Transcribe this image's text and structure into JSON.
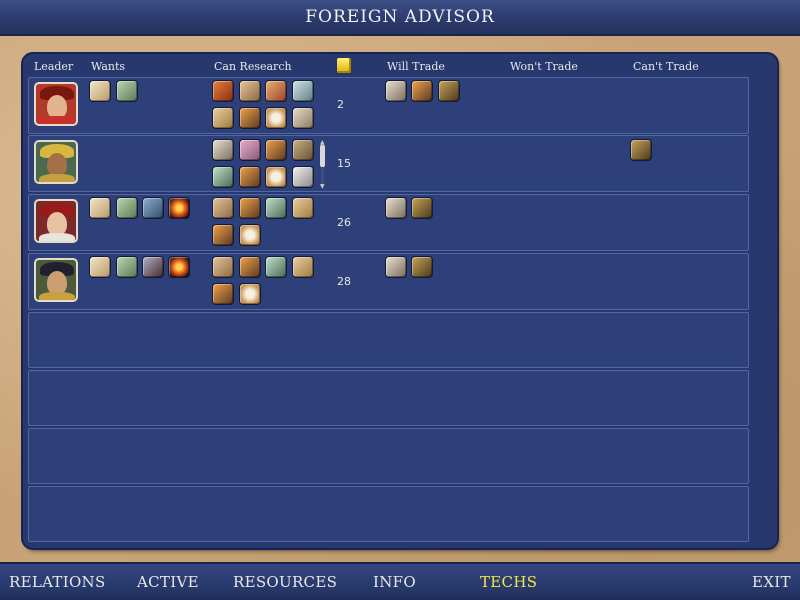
{
  "window": {
    "title": "FOREIGN ADVISOR"
  },
  "headers": {
    "leader": "Leader",
    "wants": "Wants",
    "can_research": "Can Research",
    "gold_icon": "gold-coin-icon",
    "will_trade": "Will Trade",
    "wont_trade": "Won't Trade",
    "cant_trade": "Can't Trade"
  },
  "leaders": [
    {
      "gold": "2"
    },
    {
      "gold": "15"
    },
    {
      "gold": "26"
    },
    {
      "gold": "28"
    }
  ],
  "nav": {
    "relations": "RELATIONS",
    "active": "ACTIVE",
    "resources": "RESOURCES",
    "info": "INFO",
    "techs": "TECHS",
    "exit": "EXIT"
  },
  "colors": {
    "panel": "#26386e",
    "row": "#2d4079",
    "active_tab": "#f5e64a"
  }
}
